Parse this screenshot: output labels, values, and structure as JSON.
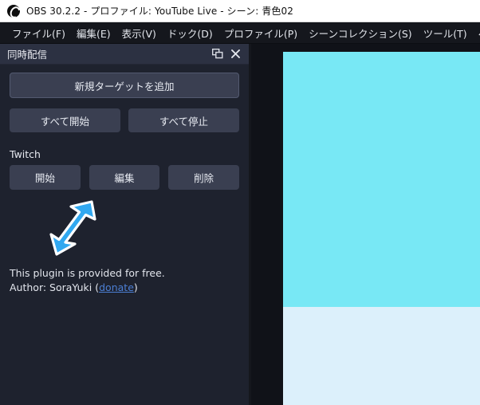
{
  "window": {
    "title": "OBS 30.2.2 - プロファイル: YouTube Live - シーン: 青色02",
    "logo_icon": "obs-logo-icon"
  },
  "menubar": {
    "items": [
      {
        "label": "ファイル(F)",
        "name": "menu-file"
      },
      {
        "label": "編集(E)",
        "name": "menu-edit"
      },
      {
        "label": "表示(V)",
        "name": "menu-view"
      },
      {
        "label": "ドック(D)",
        "name": "menu-dock"
      },
      {
        "label": "プロファイル(P)",
        "name": "menu-profile"
      },
      {
        "label": "シーンコレクション(S)",
        "name": "menu-scene-collection"
      },
      {
        "label": "ツール(T)",
        "name": "menu-tools"
      },
      {
        "label": "ヘルプ(H)",
        "name": "menu-help"
      }
    ]
  },
  "dock": {
    "title": "同時配信",
    "float_icon": "float-window-icon",
    "close_icon": "close-icon",
    "add_target_label": "新規ターゲットを追加",
    "start_all_label": "すべて開始",
    "stop_all_label": "すべて停止",
    "targets": [
      {
        "name": "Twitch",
        "start_label": "開始",
        "edit_label": "編集",
        "delete_label": "削除"
      }
    ],
    "footer": {
      "line1": "This plugin is provided for free.",
      "author_prefix": "Author: SoraYuki (",
      "donate_label": "donate",
      "author_suffix": ")"
    }
  },
  "annotation": {
    "arrow_icon": "arrow-pointer-icon",
    "fill_color": "#31A8F0",
    "stroke_color": "#FFFFFF"
  },
  "preview": {
    "background": "#101218",
    "swatches": [
      {
        "name": "cyan-block",
        "color": "#78E8F5"
      },
      {
        "name": "pale-blue-block",
        "color": "#DCF0FB"
      }
    ]
  },
  "theme": {
    "titlebar_bg": "#FFFFFF",
    "menubar_bg": "#15171D",
    "dock_header_bg": "#2C3142",
    "dock_body_bg": "#1E222E",
    "button_bg": "#3A3F51",
    "link_color": "#4C7FD4"
  }
}
